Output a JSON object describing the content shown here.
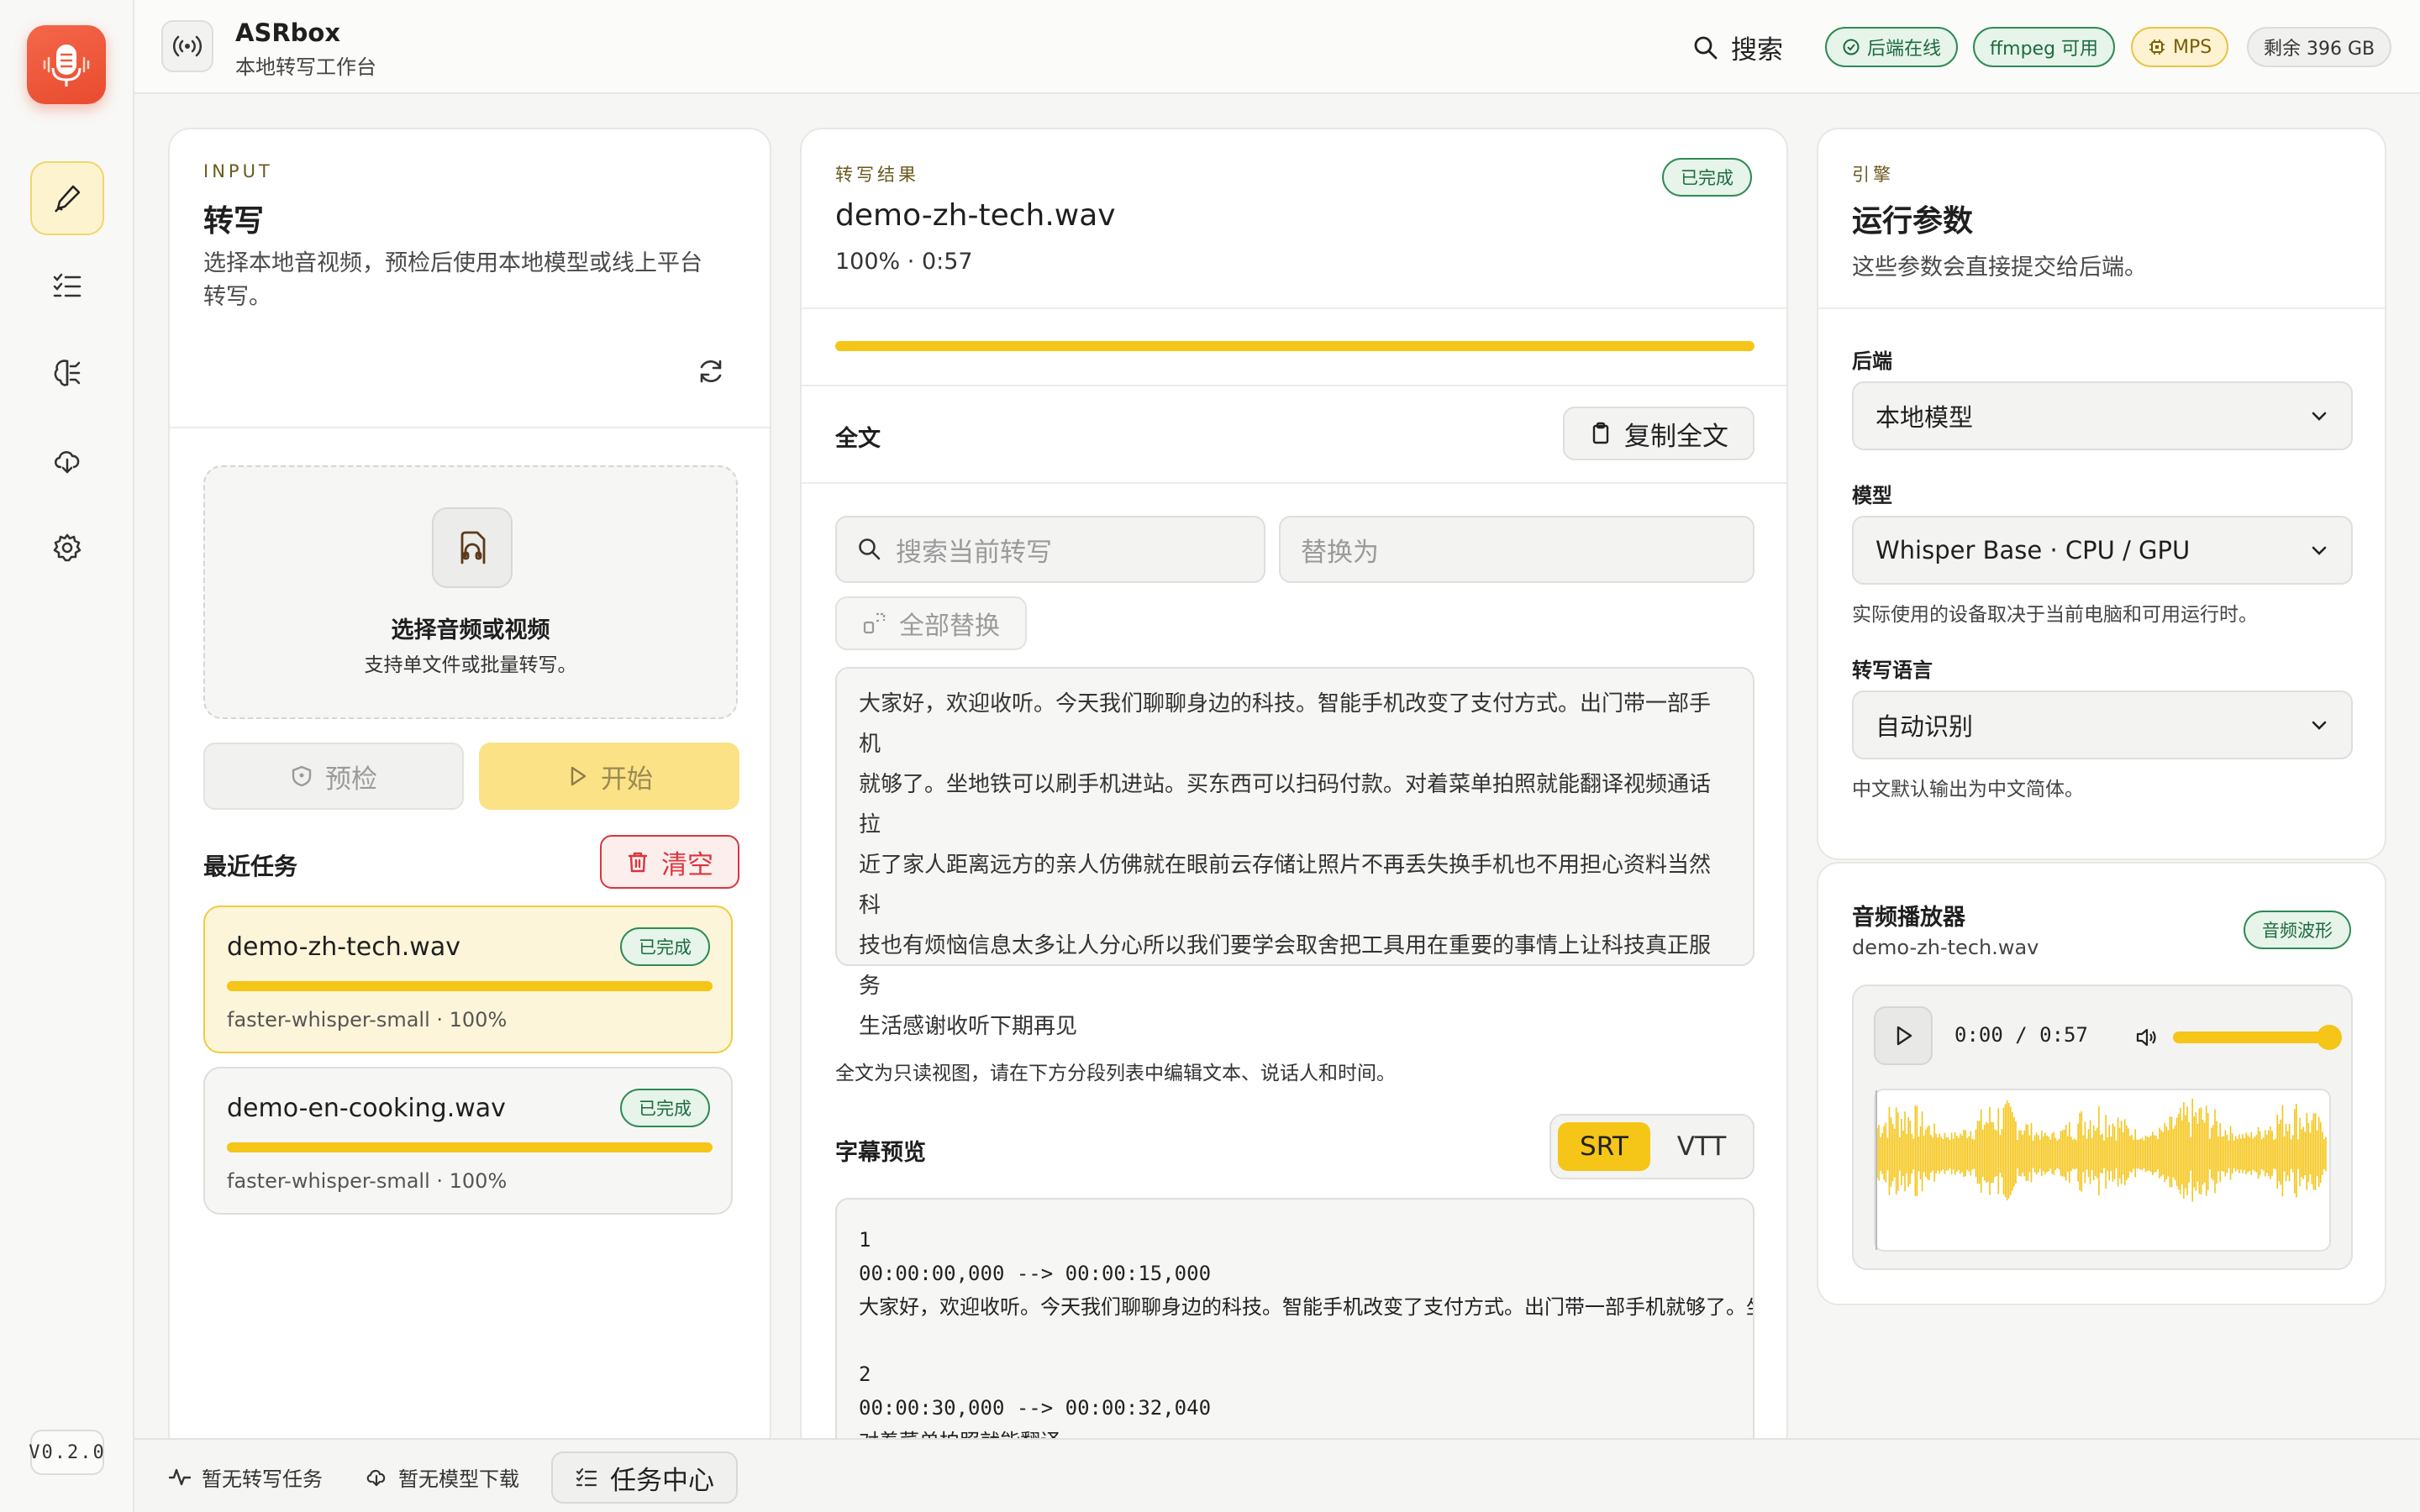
{
  "app": {
    "title": "ASRbox",
    "subtitle": "本地转写工作台",
    "version": "V0.2.0"
  },
  "sidebar": {
    "items": [
      {
        "icon": "microphone-pen-icon",
        "active": true
      },
      {
        "icon": "checklist-icon"
      },
      {
        "icon": "brain-icon"
      },
      {
        "icon": "cloud-download-icon"
      },
      {
        "icon": "gear-icon"
      }
    ]
  },
  "topbar": {
    "search_label": "搜索",
    "status": {
      "backend": "后端在线",
      "ffmpeg": "ffmpeg 可用",
      "device": "MPS",
      "disk": "剩余 396 GB"
    }
  },
  "input_panel": {
    "eyebrow": "INPUT",
    "title": "转写",
    "description": "选择本地音视频，预检后使用本地模型或线上平台转写。",
    "dropzone_title": "选择音频或视频",
    "dropzone_sub": "支持单文件或批量转写。",
    "precheck_label": "预检",
    "start_label": "开始",
    "recent_title": "最近任务",
    "clear_label": "清空",
    "tasks": [
      {
        "name": "demo-zh-tech.wav",
        "status": "已完成",
        "meta": "faster-whisper-small · 100%",
        "progress": 1.0
      },
      {
        "name": "demo-en-cooking.wav",
        "status": "已完成",
        "meta": "faster-whisper-small · 100%",
        "progress": 1.0
      }
    ]
  },
  "result_panel": {
    "eyebrow": "转写结果",
    "status": "已完成",
    "file": "demo-zh-tech.wav",
    "progress_text": "100% · 0:57",
    "progress": 1.0,
    "fulltext_label": "全文",
    "copy_label": "复制全文",
    "search_placeholder": "搜索当前转写",
    "replace_placeholder": "替换为",
    "replace_all_label": "全部替换",
    "fulltext_lines": [
      "大家好，欢迎收听。今天我们聊聊身边的科技。智能手机改变了支付方式。出门带一部手机",
      "就够了。坐地铁可以刷手机进站。买东西可以扫码付款。对着菜单拍照就能翻译视频通话拉",
      "近了家人距离远方的亲人仿佛就在眼前云存储让照片不再丢失换手机也不用担心资料当然科",
      "技也有烦恼信息太多让人分心所以我们要学会取舍把工具用在重要的事情上让科技真正服务",
      "生活感谢收听下期再见"
    ],
    "fulltext_note": "全文为只读视图，请在下方分段列表中编辑文本、说话人和时间。",
    "subtitle_label": "字幕预览",
    "format_srt": "SRT",
    "format_vtt": "VTT",
    "srt_lines": [
      "1",
      "00:00:00,000 --> 00:00:15,000",
      "大家好，欢迎收听。今天我们聊聊身边的科技。智能手机改变了支付方式。出门带一部手机就够了。坐",
      "",
      "2",
      "00:00:30,000 --> 00:00:32,040",
      "对着菜单拍照就能翻译"
    ]
  },
  "engine_panel": {
    "eyebrow": "引擎",
    "title": "运行参数",
    "description": "这些参数会直接提交给后端。",
    "backend_label": "后端",
    "backend_value": "本地模型",
    "model_label": "模型",
    "model_value": "Whisper Base · CPU / GPU",
    "model_hint": "实际使用的设备取决于当前电脑和可用运行时。",
    "language_label": "转写语言",
    "language_value": "自动识别",
    "language_hint": "中文默认输出为中文简体。"
  },
  "player_panel": {
    "title": "音频播放器",
    "file": "demo-zh-tech.wav",
    "badge": "音频波形",
    "time": "0:00 / 0:57",
    "volume": 1.0
  },
  "bottombar": {
    "transcribe_status": "暂无转写任务",
    "download_status": "暂无模型下载",
    "task_center_label": "任务中心"
  },
  "colors": {
    "accent": "#f5c518",
    "success": "#2f8a55",
    "danger": "#d9363e",
    "logo": "#ef5a3c"
  }
}
